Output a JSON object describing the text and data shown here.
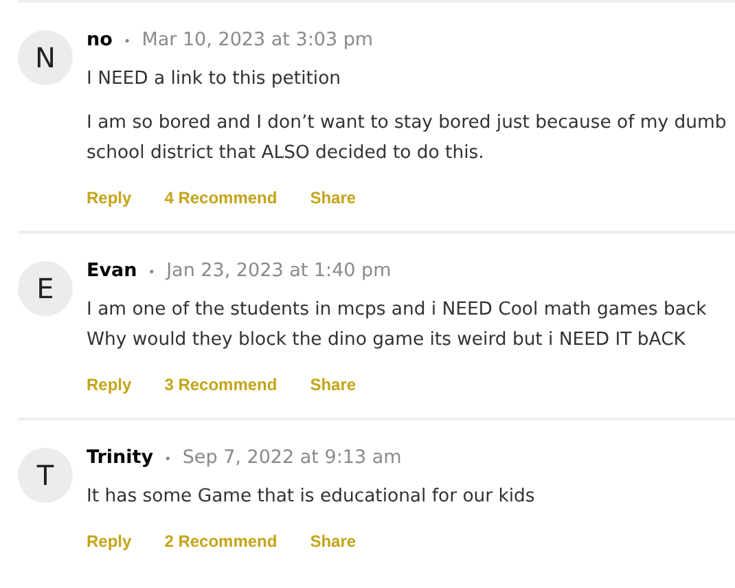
{
  "comments": [
    {
      "initial": "N",
      "author": "no",
      "separator": "•",
      "date": "Mar 10, 2023 at 3:03 pm",
      "paragraphs": [
        "I NEED a link to this petition",
        "I am so bored and I don’t want to stay bored just because of my dumb school district that ALSO decided to do this."
      ],
      "actions": [
        "Reply",
        "4 Recommend",
        "Share"
      ]
    },
    {
      "initial": "E",
      "author": "Evan",
      "separator": "•",
      "date": "Jan 23, 2023 at 1:40 pm",
      "paragraphs": [
        "I am one of the students in mcps and i NEED Cool math games back Why would they block the dino game its weird but i NEED IT bACK"
      ],
      "actions": [
        "Reply",
        "3 Recommend",
        "Share"
      ]
    },
    {
      "initial": "T",
      "author": "Trinity",
      "separator": "•",
      "date": "Sep 7, 2022 at 9:13 am",
      "paragraphs": [
        "It has some Game that is educational for our kids"
      ],
      "actions": [
        "Reply",
        "2 Recommend",
        "Share"
      ]
    }
  ]
}
